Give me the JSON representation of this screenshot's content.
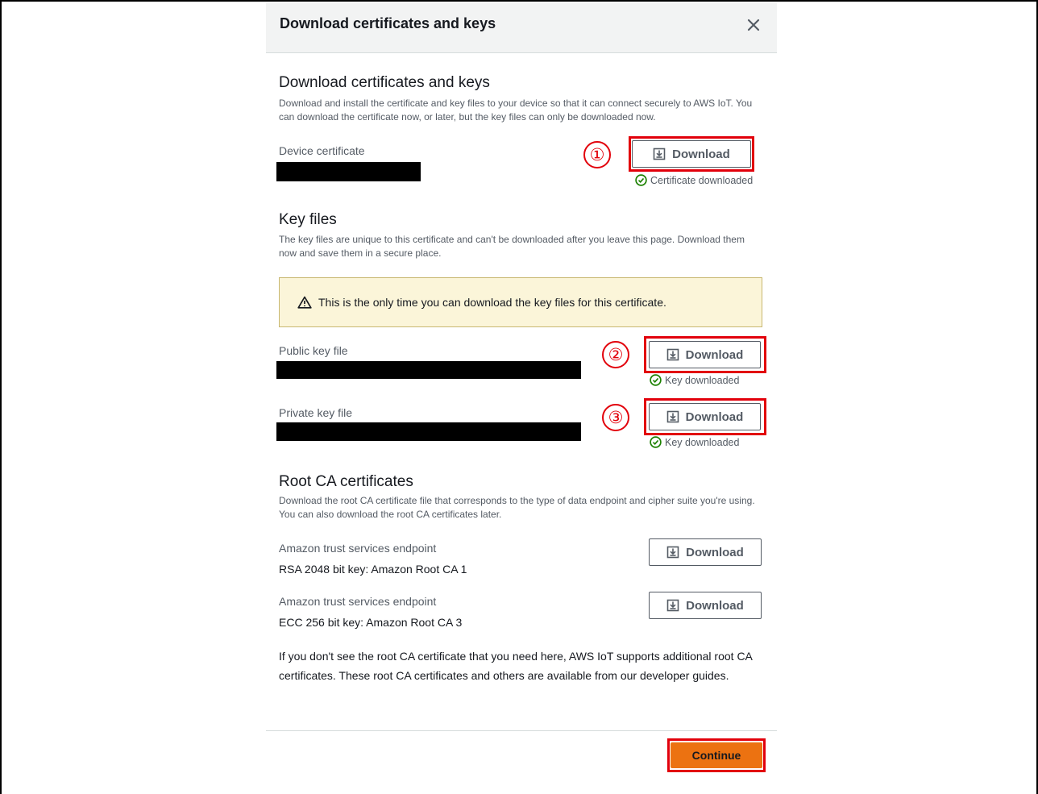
{
  "dialog": {
    "title": "Download certificates and keys"
  },
  "cert_section": {
    "heading": "Download certificates and keys",
    "description": "Download and install the certificate and key files to your device so that it can connect securely to AWS IoT. You can download the certificate now, or later, but the key files can only be downloaded now.",
    "device_cert_label": "Device certificate",
    "download_label": "Download",
    "status": "Certificate downloaded",
    "step": "①"
  },
  "key_section": {
    "heading": "Key files",
    "description": "The key files are unique to this certificate and can't be downloaded after you leave this page. Download them now and save them in a secure place.",
    "alert": "This is the only time you can download the key files for this certificate.",
    "public_label": "Public key file",
    "private_label": "Private key file",
    "download_label": "Download",
    "status": "Key downloaded",
    "step_public": "②",
    "step_private": "③"
  },
  "root_ca": {
    "heading": "Root CA certificates",
    "description": "Download the root CA certificate file that corresponds to the type of data endpoint and cipher suite you're using. You can also download the root CA certificates later.",
    "items": [
      {
        "title": "Amazon trust services endpoint",
        "subtitle": "RSA 2048 bit key: Amazon Root CA 1",
        "download_label": "Download"
      },
      {
        "title": "Amazon trust services endpoint",
        "subtitle": "ECC 256 bit key: Amazon Root CA 3",
        "download_label": "Download"
      }
    ],
    "footnote": "If you don't see the root CA certificate that you need here, AWS IoT supports additional root CA certificates. These root CA certificates and others are available from our developer guides."
  },
  "footer": {
    "continue_label": "Continue"
  },
  "colors": {
    "highlight": "#e2000b",
    "primary": "#ec7211",
    "success": "#1d8102",
    "alert_bg": "#fbf5d9"
  }
}
